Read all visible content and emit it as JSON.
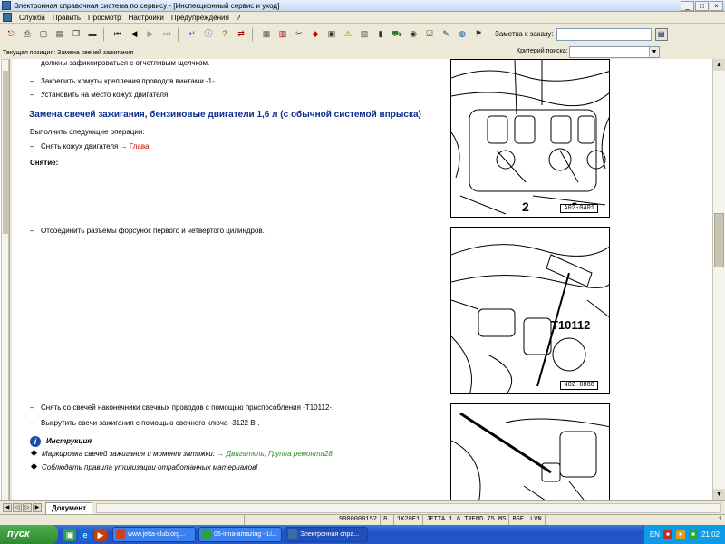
{
  "window": {
    "title": "Электронная справочная система по сервису - [Инспекционный сервис и уход]",
    "buttons": [
      "_",
      "□",
      "×"
    ]
  },
  "menu": [
    "Служба",
    "Править",
    "Просмотр",
    "Настройки",
    "Предупреждения",
    "?"
  ],
  "toolbar": {
    "icons": [
      {
        "name": "exit-icon",
        "glyph": "⎋",
        "color": "#b00000"
      },
      {
        "name": "print-icon",
        "glyph": "⎙",
        "color": "#333333"
      },
      {
        "name": "new-doc-icon",
        "glyph": "▢",
        "color": "#333333"
      },
      {
        "name": "open-doc-icon",
        "glyph": "▤",
        "color": "#333333"
      },
      {
        "name": "copy-icon",
        "glyph": "❐",
        "color": "#333333"
      },
      {
        "name": "car-icon",
        "glyph": "▬",
        "color": "#333333"
      },
      {
        "name": "first-page-icon",
        "glyph": "⏮",
        "color": "#000000"
      },
      {
        "name": "prev-page-icon",
        "glyph": "◀",
        "color": "#000000"
      },
      {
        "name": "next-page-icon",
        "glyph": "▶",
        "color": "#999999"
      },
      {
        "name": "last-page-icon",
        "glyph": "⏭",
        "color": "#999999"
      },
      {
        "name": "back-icon",
        "glyph": "↵",
        "color": "#0044aa"
      },
      {
        "name": "info-icon",
        "glyph": "ⓘ",
        "color": "#0033aa"
      },
      {
        "name": "help-icon",
        "glyph": "?",
        "color": "#806000"
      },
      {
        "name": "swap-icon",
        "glyph": "⇄",
        "color": "#aa0000"
      },
      {
        "name": "grid-icon",
        "glyph": "▦",
        "color": "#555555"
      },
      {
        "name": "book-icon",
        "glyph": "▥",
        "color": "#b00000"
      },
      {
        "name": "tools-icon",
        "glyph": "✂",
        "color": "#333333"
      },
      {
        "name": "tag-icon",
        "glyph": "◆",
        "color": "#cc0000"
      },
      {
        "name": "document-icon",
        "glyph": "▣",
        "color": "#333333"
      },
      {
        "name": "warning-icon",
        "glyph": "⚠",
        "color": "#b08000"
      },
      {
        "name": "measure-icon",
        "glyph": "▧",
        "color": "#555555"
      },
      {
        "name": "battery-icon",
        "glyph": "▮",
        "color": "#333333"
      },
      {
        "name": "vehicle-icon",
        "glyph": "⛟",
        "color": "#2a7a2a"
      },
      {
        "name": "wheel-icon",
        "glyph": "◉",
        "color": "#333333"
      },
      {
        "name": "check-list-icon",
        "glyph": "☑",
        "color": "#006600"
      },
      {
        "name": "edit-icon",
        "glyph": "✎",
        "color": "#333333"
      },
      {
        "name": "globe-icon",
        "glyph": "◍",
        "color": "#0055aa"
      },
      {
        "name": "flag-icon",
        "glyph": "⚑",
        "color": "#333333"
      }
    ],
    "order_label": "Заметка к заказу:",
    "order_value": ""
  },
  "position": {
    "label": "Текущая позиция: Замена свечей зажигания",
    "criteria_label": "Критерий поиска:",
    "criteria_value": ""
  },
  "content": {
    "line1": "должны зафиксироваться с отчетливым щелчком.",
    "step1": "Закрепить хомуты крепления проводов винтами -1-.",
    "step2": "Установить на место кожух двигателя.",
    "heading": "Замена свечей зажигания, бензиновые двигатели 1,6 л (с обычной системой впрыска)",
    "intro": "Выполнить следующие операции:",
    "step3_prefix": "Снять кожух двигателя",
    "step3_link": "→ Глава.",
    "removal": "Снятие:",
    "step4": "Отсоединить разъёмы форсунок первого и четвертого цилиндров.",
    "step5": "Снять со свечей наконечники свечных проводов с помощью приспособления -T10112-.",
    "step6": "Выкрутить свечи зажигания с помощью свечного ключа -3122 B-.",
    "instruction_title": "Инструкция",
    "bullet1_prefix": "Маркировка свечей зажигания и момент затяжки:",
    "bullet1_link": "→ Двигатель; Группа ремонта28",
    "bullet2": "Соблюдать правила утилизации отработанных материалов!",
    "dash": "–"
  },
  "illustrations": [
    {
      "code": "A02-0401",
      "labels": [
        "2",
        "2"
      ]
    },
    {
      "code": "N02-0888",
      "labels": [
        "T10112"
      ]
    },
    {
      "code": ""
    }
  ],
  "bottom": {
    "tab": "Документ"
  },
  "status": [
    "9000000152",
    "8",
    "1K20E1",
    "JETTA 1.6 TREND 75 MS",
    "BSE",
    "LVN",
    "1"
  ],
  "taskbar": {
    "start": "пуск",
    "tasks": [
      {
        "label": "www.jetta-club.org...",
        "color": "#d04020"
      },
      {
        "label": "06-irina-amazing - Li...",
        "color": "#2aa04a"
      },
      {
        "label": "Электронная спра...",
        "color": "#3a6ea5"
      }
    ],
    "lang": "EN",
    "time": "21:02"
  }
}
